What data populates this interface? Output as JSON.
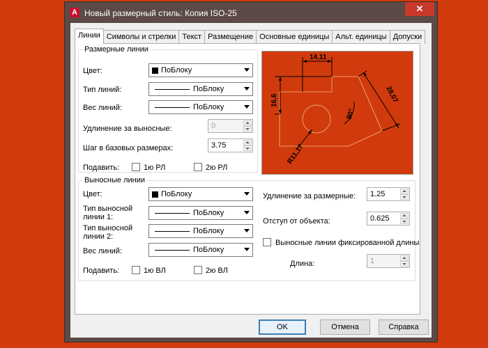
{
  "window": {
    "title": "Новый размерный стиль: Копия ISO-25",
    "close": "✕"
  },
  "tabs": [
    "Линии",
    "Символы и стрелки",
    "Текст",
    "Размещение",
    "Основные единицы",
    "Альт. единицы",
    "Допуски"
  ],
  "dim_lines": {
    "title": "Размерные линии",
    "color_label": "Цвет:",
    "color_value": "ПоБлоку",
    "linetype_label": "Тип линий:",
    "linetype_value": "ПоБлоку",
    "lineweight_label": "Вес линий:",
    "lineweight_value": "ПоБлоку",
    "extend_label": "Удлинение за выносные:",
    "extend_value": "0",
    "baseline_label": "Шаг в базовых размерах:",
    "baseline_value": "3.75",
    "suppress_label": "Подавить:",
    "suppress_1": "1ю РЛ",
    "suppress_2": "2ю РЛ"
  },
  "ext_lines": {
    "title": "Выносные линии",
    "color_label": "Цвет:",
    "color_value": "ПоБлоку",
    "linetype1_label": "Тип выносной линии 1:",
    "linetype1_value": "ПоБлоку",
    "linetype2_label": "Тип выносной линии 2:",
    "linetype2_value": "ПоБлоку",
    "lineweight_label": "Вес линий:",
    "lineweight_value": "ПоБлоку",
    "suppress_label": "Подавить:",
    "suppress_1": "1ю ВЛ",
    "suppress_2": "2ю ВЛ",
    "extend_label": "Удлинение за размерные:",
    "extend_value": "1.25",
    "offset_label": "Отступ от объекта:",
    "offset_value": "0.625",
    "fixed_label": "Выносные линии фиксированной длины",
    "length_label": "Длина:",
    "length_value": "1"
  },
  "preview": {
    "dim_top": "14,11",
    "dim_left": "16,6",
    "dim_right": "28,07",
    "dim_angle": "80°",
    "dim_radius": "R11,17"
  },
  "buttons": {
    "ok": "OK",
    "cancel": "Отмена",
    "help": "Справка"
  },
  "colors": {
    "background": "#d13a0c",
    "window_frame": "#5b4a46",
    "close": "#c8392a"
  }
}
